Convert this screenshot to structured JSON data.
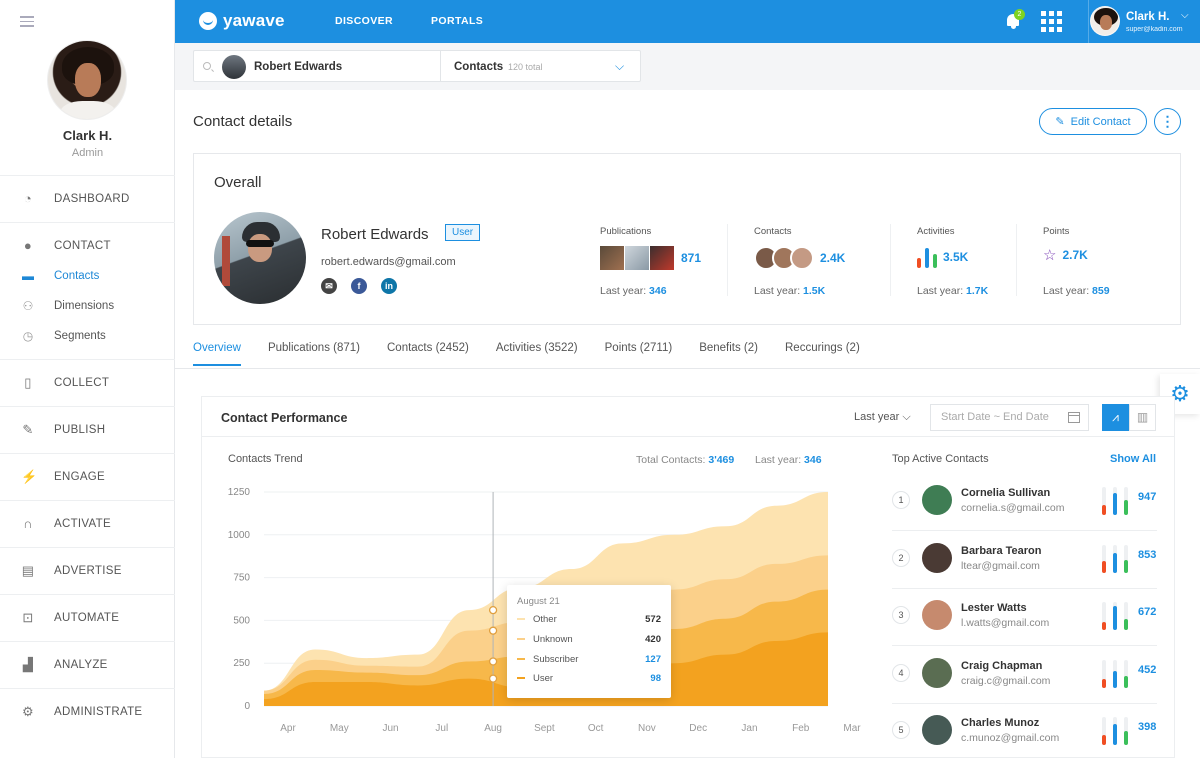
{
  "sidebar": {
    "user": {
      "name": "Clark H.",
      "role": "Admin"
    },
    "nav": [
      {
        "key": "dashboard",
        "label": "DASHBOARD",
        "icon": "gauge-icon"
      },
      {
        "key": "contact",
        "label": "CONTACT",
        "icon": "person-icon",
        "children": [
          {
            "label": "Contacts",
            "icon": "contact-card-icon",
            "active": true
          },
          {
            "label": "Dimensions",
            "icon": "people-icon"
          },
          {
            "label": "Segments",
            "icon": "pie-icon"
          }
        ]
      },
      {
        "key": "collect",
        "label": "COLLECT",
        "icon": "columns-icon"
      },
      {
        "key": "publish",
        "label": "PUBLISH",
        "icon": "pen-icon"
      },
      {
        "key": "engage",
        "label": "ENGAGE",
        "icon": "bolt-icon"
      },
      {
        "key": "activate",
        "label": "ACTIVATE",
        "icon": "magnet-icon"
      },
      {
        "key": "advertise",
        "label": "ADVERTISE",
        "icon": "billboard-icon"
      },
      {
        "key": "automate",
        "label": "AUTOMATE",
        "icon": "robot-icon"
      },
      {
        "key": "analyze",
        "label": "ANALYZE",
        "icon": "analytics-icon"
      },
      {
        "key": "administrate",
        "label": "ADMINISTRATE",
        "icon": "gear-icon"
      }
    ]
  },
  "header": {
    "brand": "yawave",
    "nav": [
      "DISCOVER",
      "PORTALS"
    ],
    "notifications": "2",
    "user": {
      "name": "Clark H.",
      "email": "super@kadin.com"
    }
  },
  "search": {
    "person": "Robert Edwards",
    "type": "Contacts",
    "total": "120 total"
  },
  "page": {
    "title": "Contact details",
    "edit_label": "Edit Contact",
    "more_label": "⋮"
  },
  "overall": {
    "title": "Overall",
    "name": "Robert Edwards",
    "badge": "User",
    "email": "robert.edwards@gmail.com",
    "social": [
      "email-icon",
      "facebook-icon",
      "linkedin-icon"
    ],
    "stats": [
      {
        "label": "Publications",
        "value": "871",
        "last_label": "Last year:",
        "last": "346"
      },
      {
        "label": "Contacts",
        "value": "2.4K",
        "last_label": "Last year:",
        "last": "1.5K"
      },
      {
        "label": "Activities",
        "value": "3.5K",
        "last_label": "Last year:",
        "last": "1.7K"
      },
      {
        "label": "Points",
        "value": "2.7K",
        "last_label": "Last year:",
        "last": "859"
      }
    ]
  },
  "tabs": [
    {
      "label": "Overview",
      "active": true
    },
    {
      "label": "Publications (871)"
    },
    {
      "label": "Contacts (2452)"
    },
    {
      "label": "Activities (3522)"
    },
    {
      "label": "Points (2711)"
    },
    {
      "label": "Benefits (2)"
    },
    {
      "label": "Reccurings (2)"
    }
  ],
  "performance": {
    "title": "Contact Performance",
    "period": "Last year",
    "date_placeholder": "Start Date ~ End Date",
    "trend_title": "Contacts Trend",
    "total_label": "Total Contacts:",
    "total_value": "3'469",
    "last_label": "Last year:",
    "last_value": "346",
    "tooltip": {
      "date": "August 21",
      "rows": [
        {
          "label": "Other",
          "value": "572",
          "color": "#fde3b0"
        },
        {
          "label": "Unknown",
          "value": "420",
          "color": "#fbd08a"
        },
        {
          "label": "Subscriber",
          "value": "127",
          "color": "#f7b84a"
        },
        {
          "label": "User",
          "value": "98",
          "color": "#f3a21f"
        }
      ]
    }
  },
  "chart_data": {
    "type": "area",
    "title": "Contacts Trend",
    "x": [
      "Apr",
      "May",
      "Jun",
      "Jul",
      "Aug",
      "Sept",
      "Oct",
      "Nov",
      "Dec",
      "Jan",
      "Feb",
      "Mar"
    ],
    "ylim": [
      0,
      1250
    ],
    "yticks": [
      0,
      250,
      500,
      750,
      1000,
      1250
    ],
    "stacked": true,
    "grid": true,
    "series": [
      {
        "name": "User",
        "color": "#f3a21f",
        "values": [
          40,
          140,
          140,
          120,
          160,
          110,
          140,
          200,
          250,
          300,
          380,
          430
        ]
      },
      {
        "name": "Subscriber",
        "color": "#f7b84a",
        "values": [
          30,
          70,
          55,
          60,
          100,
          180,
          180,
          190,
          200,
          210,
          230,
          250
        ]
      },
      {
        "name": "Unknown",
        "color": "#fbd08a",
        "values": [
          20,
          60,
          40,
          50,
          180,
          200,
          180,
          200,
          230,
          230,
          220,
          200
        ]
      },
      {
        "name": "Other",
        "color": "#fde3b0",
        "values": [
          0,
          60,
          45,
          70,
          120,
          200,
          300,
          360,
          320,
          310,
          340,
          370
        ]
      }
    ],
    "marker_x": "Aug"
  },
  "top_contacts": {
    "title": "Top Active Contacts",
    "show_all": "Show All",
    "items": [
      {
        "rank": "1",
        "name": "Cornelia Sullivan",
        "email": "cornelia.s@gmail.com",
        "value": "947",
        "bars": [
          0.35,
          0.8,
          0.55
        ],
        "avatar": "#3f7d54"
      },
      {
        "rank": "2",
        "name": "Barbara Tearon",
        "email": "ltear@gmail.com",
        "value": "853",
        "bars": [
          0.4,
          0.7,
          0.45
        ],
        "avatar": "#4a3a34"
      },
      {
        "rank": "3",
        "name": "Lester Watts",
        "email": "l.watts@gmail.com",
        "value": "672",
        "bars": [
          0.3,
          0.85,
          0.4
        ],
        "avatar": "#c68a6e"
      },
      {
        "rank": "4",
        "name": "Craig Chapman",
        "email": "craig.c@gmail.com",
        "value": "452",
        "bars": [
          0.3,
          0.6,
          0.4
        ],
        "avatar": "#5a6d52"
      },
      {
        "rank": "5",
        "name": "Charles Munoz",
        "email": "c.munoz@gmail.com",
        "value": "398",
        "bars": [
          0.35,
          0.75,
          0.5
        ],
        "avatar": "#465a55"
      }
    ]
  },
  "colors": {
    "primary": "#1d8fe0",
    "accent_green": "#7ed321",
    "bar_red": "#f04e23",
    "bar_blue": "#1d8fe0",
    "bar_green": "#3bbf5a"
  }
}
